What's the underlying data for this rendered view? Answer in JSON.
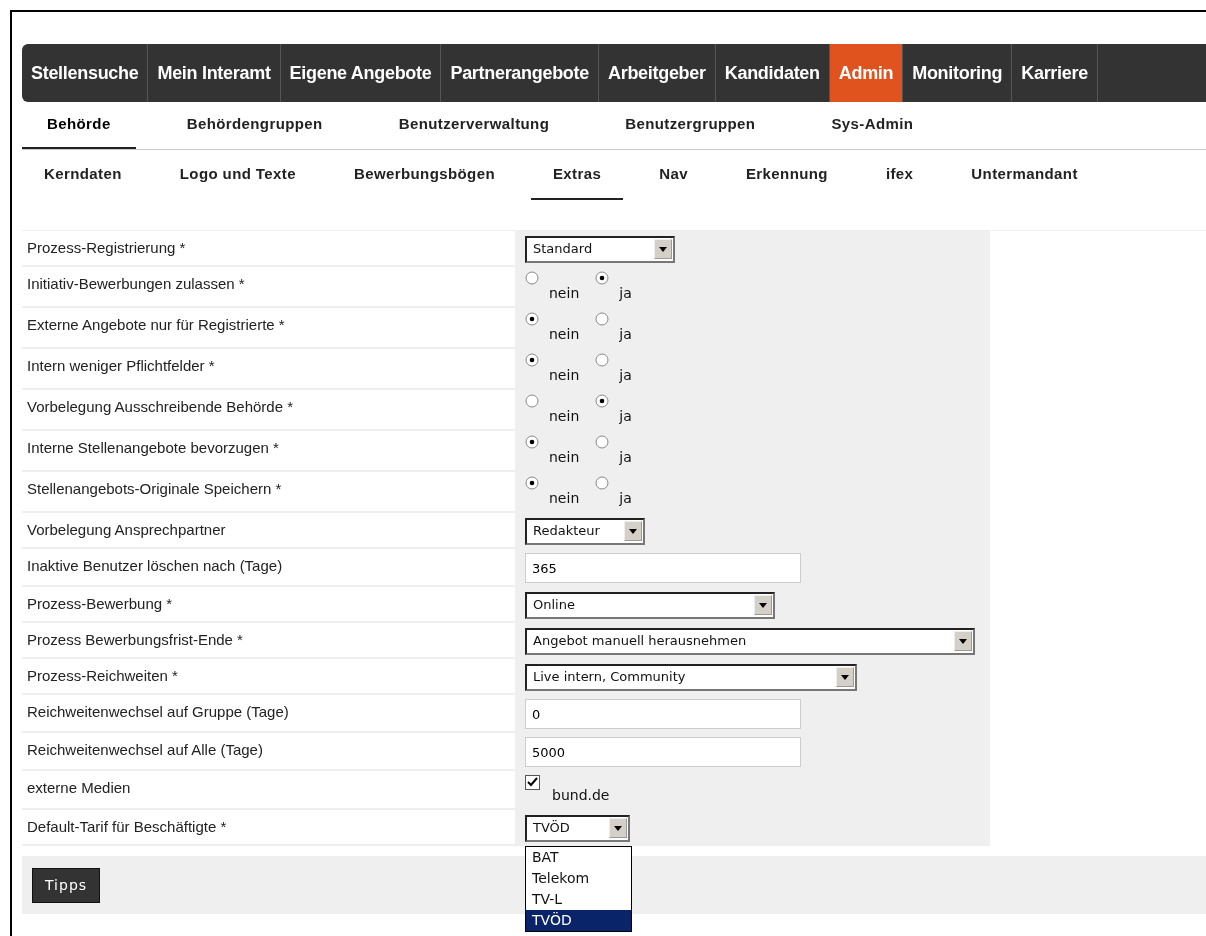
{
  "main_nav": [
    {
      "label": "Stellensuche",
      "selected": false
    },
    {
      "label": "Mein Interamt",
      "selected": false
    },
    {
      "label": "Eigene Angebote",
      "selected": false
    },
    {
      "label": "Partnerangebote",
      "selected": false
    },
    {
      "label": "Arbeitgeber",
      "selected": false
    },
    {
      "label": "Kandidaten",
      "selected": false
    },
    {
      "label": "Admin",
      "selected": true
    },
    {
      "label": "Monitoring",
      "selected": false
    },
    {
      "label": "Karriere",
      "selected": false
    }
  ],
  "sub_nav": [
    {
      "label": "Behörde",
      "selected": true
    },
    {
      "label": "Behördengruppen",
      "selected": false
    },
    {
      "label": "Benutzerverwaltung",
      "selected": false
    },
    {
      "label": "Benutzergruppen",
      "selected": false
    },
    {
      "label": "Sys-Admin",
      "selected": false
    }
  ],
  "section_tabs": [
    {
      "label": "Kerndaten",
      "selected": false
    },
    {
      "label": "Logo und Texte",
      "selected": false
    },
    {
      "label": "Bewerbungsbögen",
      "selected": false
    },
    {
      "label": "Extras",
      "selected": true
    },
    {
      "label": "Nav",
      "selected": false
    },
    {
      "label": "Erkennung",
      "selected": false
    },
    {
      "label": "ifex",
      "selected": false
    },
    {
      "label": "Untermandant",
      "selected": false
    }
  ],
  "form_rows": [
    {
      "label": "Prozess-Registrierung *",
      "kind": "select",
      "value": "Standard"
    },
    {
      "label": "Initiativ-Bewerbungen zulassen *",
      "kind": "radio",
      "options": [
        {
          "label": "nein",
          "selected": false
        },
        {
          "label": "ja",
          "selected": true
        }
      ]
    },
    {
      "label": "Externe Angebote nur für Registrierte *",
      "kind": "radio",
      "options": [
        {
          "label": "nein",
          "selected": true
        },
        {
          "label": "ja",
          "selected": false
        }
      ]
    },
    {
      "label": "Intern weniger Pflichtfelder *",
      "kind": "radio",
      "options": [
        {
          "label": "nein",
          "selected": true
        },
        {
          "label": "ja",
          "selected": false
        }
      ]
    },
    {
      "label": "Vorbelegung Ausschreibende Behörde *",
      "kind": "radio",
      "options": [
        {
          "label": "nein",
          "selected": false
        },
        {
          "label": "ja",
          "selected": true
        }
      ]
    },
    {
      "label": "Interne Stellenangebote bevorzugen *",
      "kind": "radio",
      "options": [
        {
          "label": "nein",
          "selected": true
        },
        {
          "label": "ja",
          "selected": false
        }
      ]
    },
    {
      "label": "Stellenangebots-Originale Speichern *",
      "kind": "radio",
      "options": [
        {
          "label": "nein",
          "selected": true
        },
        {
          "label": "ja",
          "selected": false
        }
      ]
    },
    {
      "label": "Vorbelegung Ansprechpartner",
      "kind": "select",
      "value": "Redakteur"
    },
    {
      "label": "Inaktive Benutzer löschen nach (Tage)",
      "kind": "text",
      "value": "365"
    },
    {
      "label": "Prozess-Bewerbung *",
      "kind": "select",
      "value": "Online"
    },
    {
      "label": "Prozess Bewerbungsfrist-Ende *",
      "kind": "select",
      "value": "Angebot manuell herausnehmen"
    },
    {
      "label": "Prozess-Reichweiten *",
      "kind": "select",
      "value": "Live intern, Community"
    },
    {
      "label": "Reichweitenwechsel auf Gruppe (Tage)",
      "kind": "text",
      "value": "0"
    },
    {
      "label": "Reichweitenwechsel auf Alle (Tage)",
      "kind": "text",
      "value": "5000"
    },
    {
      "label": "externe Medien",
      "kind": "checkbox",
      "option": {
        "label": "bund.de",
        "checked": true
      }
    },
    {
      "label": "Default-Tarif für Beschäftigte *",
      "kind": "select",
      "value": "TVÖD",
      "expanded": true,
      "options": [
        {
          "label": "BAT",
          "selected": false
        },
        {
          "label": "Telekom",
          "selected": false
        },
        {
          "label": "TV-L",
          "selected": false
        },
        {
          "label": "TVÖD",
          "selected": true
        }
      ]
    }
  ],
  "tips_button": "Tipps"
}
